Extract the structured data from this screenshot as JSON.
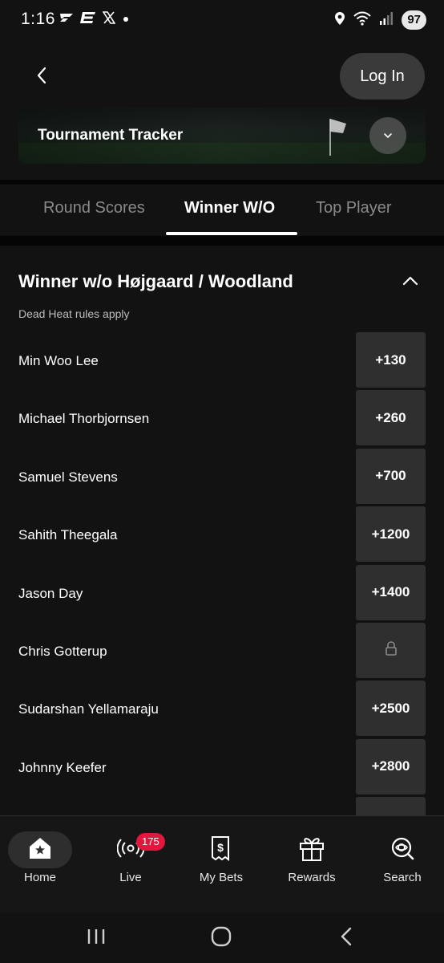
{
  "status": {
    "time": "1:16",
    "battery": "97",
    "icons": [
      "flash-icon",
      "espn-bet-icon",
      "x-icon",
      "dot-icon",
      "location-icon",
      "wifi-icon",
      "signal-icon"
    ]
  },
  "header": {
    "back_icon": "chevron-left-icon",
    "login_label": "Log In"
  },
  "tracker": {
    "title": "Tournament Tracker",
    "expand_icon": "chevron-down-icon"
  },
  "tabs": [
    {
      "label": "Round Scores",
      "active": false
    },
    {
      "label": "Winner W/O",
      "active": true
    },
    {
      "label": "Top Player",
      "active": false
    }
  ],
  "market": {
    "title": "Winner w/o Højgaard / Woodland",
    "note": "Dead Heat rules apply",
    "collapse_icon": "chevron-up-icon",
    "runners": [
      {
        "name": "Min Woo Lee",
        "odds": "+130"
      },
      {
        "name": "Michael Thorbjornsen",
        "odds": "+260"
      },
      {
        "name": "Samuel Stevens",
        "odds": "+700"
      },
      {
        "name": "Sahith Theegala",
        "odds": "+1200"
      },
      {
        "name": "Jason Day",
        "odds": "+1400"
      },
      {
        "name": "Chris Gotterup",
        "odds": "",
        "locked": true
      },
      {
        "name": "Sudarshan Yellamaraju",
        "odds": "+2500"
      },
      {
        "name": "Johnny Keefer",
        "odds": "+2800"
      }
    ]
  },
  "bottom_nav": {
    "items": [
      {
        "label": "Home",
        "icon": "home-icon",
        "active": true
      },
      {
        "label": "Live",
        "icon": "live-broadcast-icon",
        "badge": "175"
      },
      {
        "label": "My Bets",
        "icon": "bet-slip-icon"
      },
      {
        "label": "Rewards",
        "icon": "gift-icon"
      },
      {
        "label": "Search",
        "icon": "search-icon"
      }
    ]
  },
  "system_nav": [
    "recents-icon",
    "home-circle-icon",
    "back-icon"
  ],
  "colors": {
    "background": "#121212",
    "odds_button": "#2f2f2f",
    "live_badge": "#e3173e",
    "login_button": "#3a3a3a"
  }
}
